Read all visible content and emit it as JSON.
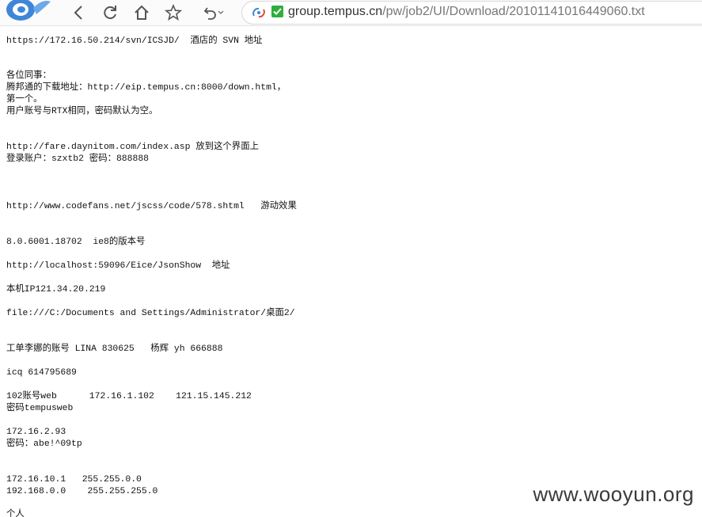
{
  "browser": {
    "url_domain": "group.tempus.cn",
    "url_path": "/pw/job2/UI/Download/20101141016449060.txt",
    "icons": [
      "logo-icon",
      "back-icon",
      "reload-icon",
      "home-icon",
      "favorite-star-icon",
      "undo-icon",
      "chevron-down-icon",
      "address-bar-icon",
      "secure-check-icon"
    ]
  },
  "document": {
    "lines": [
      "https://172.16.50.214/svn/ICSJD/  酒店的 SVN 地址",
      "各位同事：",
      "腾邦通的下载地址：http://eip.tempus.cn:8000/down.html，",
      "第一个。",
      "用户账号与RTX相同，密码默认为空。",
      "http://fare.daynitom.com/index.asp 放到这个界面上",
      "登录账户：szxtb2 密码：888888",
      "http://www.codefans.net/jscss/code/578.shtml   游动效果",
      "8.0.6001.18702  ie8的版本号",
      "http://localhost:59096/Eice/JsonShow  地址",
      "本机IP121.34.20.219",
      "file:///C:/Documents and Settings/Administrator/桌面2/",
      "工单李娜的账号 LINA 830625   杨辉 yh 666888",
      "icq 614795689",
      "102账号web      172.16.1.102    121.15.145.212",
      "密码tempusweb",
      "172.16.2.93",
      "密码：abe!^09tp",
      "172.16.10.1   255.255.0.0",
      "192.168.0.0    255.255.255.0",
      "个人"
    ]
  },
  "watermark": "www.wooyun.org"
}
